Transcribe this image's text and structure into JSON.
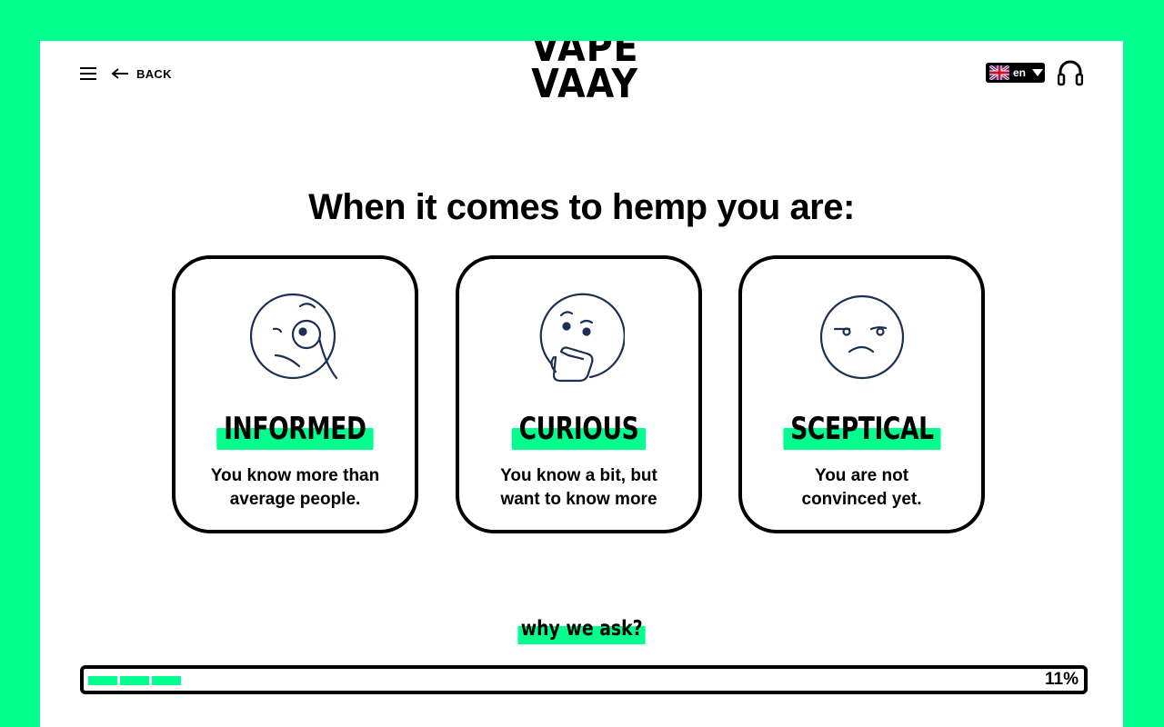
{
  "header": {
    "back_label": "BACK",
    "logo_line1": "VAPE",
    "logo_line2": "VAAY",
    "language_code": "en",
    "menu_icon": "hamburger-menu-icon",
    "back_icon": "arrow-left-icon",
    "audio_icon": "headphones-icon"
  },
  "question": "When it comes to hemp you are:",
  "options": [
    {
      "title": "INFORMED",
      "desc_line1": "You know more than",
      "desc_line2": "average people.",
      "icon": "monocle-face-icon"
    },
    {
      "title": "CURIOUS",
      "desc_line1": "You know a bit, but",
      "desc_line2": "want to know more",
      "icon": "thinking-face-icon"
    },
    {
      "title": "SCEPTICAL",
      "desc_line1": "You are not",
      "desc_line2": "convinced yet.",
      "icon": "sceptical-face-icon"
    }
  ],
  "why_link": "why we ask?",
  "progress": {
    "percent_label": "11%",
    "value": 0.11
  },
  "colors": {
    "accent": "#00ff8c",
    "icon_stroke": "#1d2f52",
    "text": "#000000"
  }
}
